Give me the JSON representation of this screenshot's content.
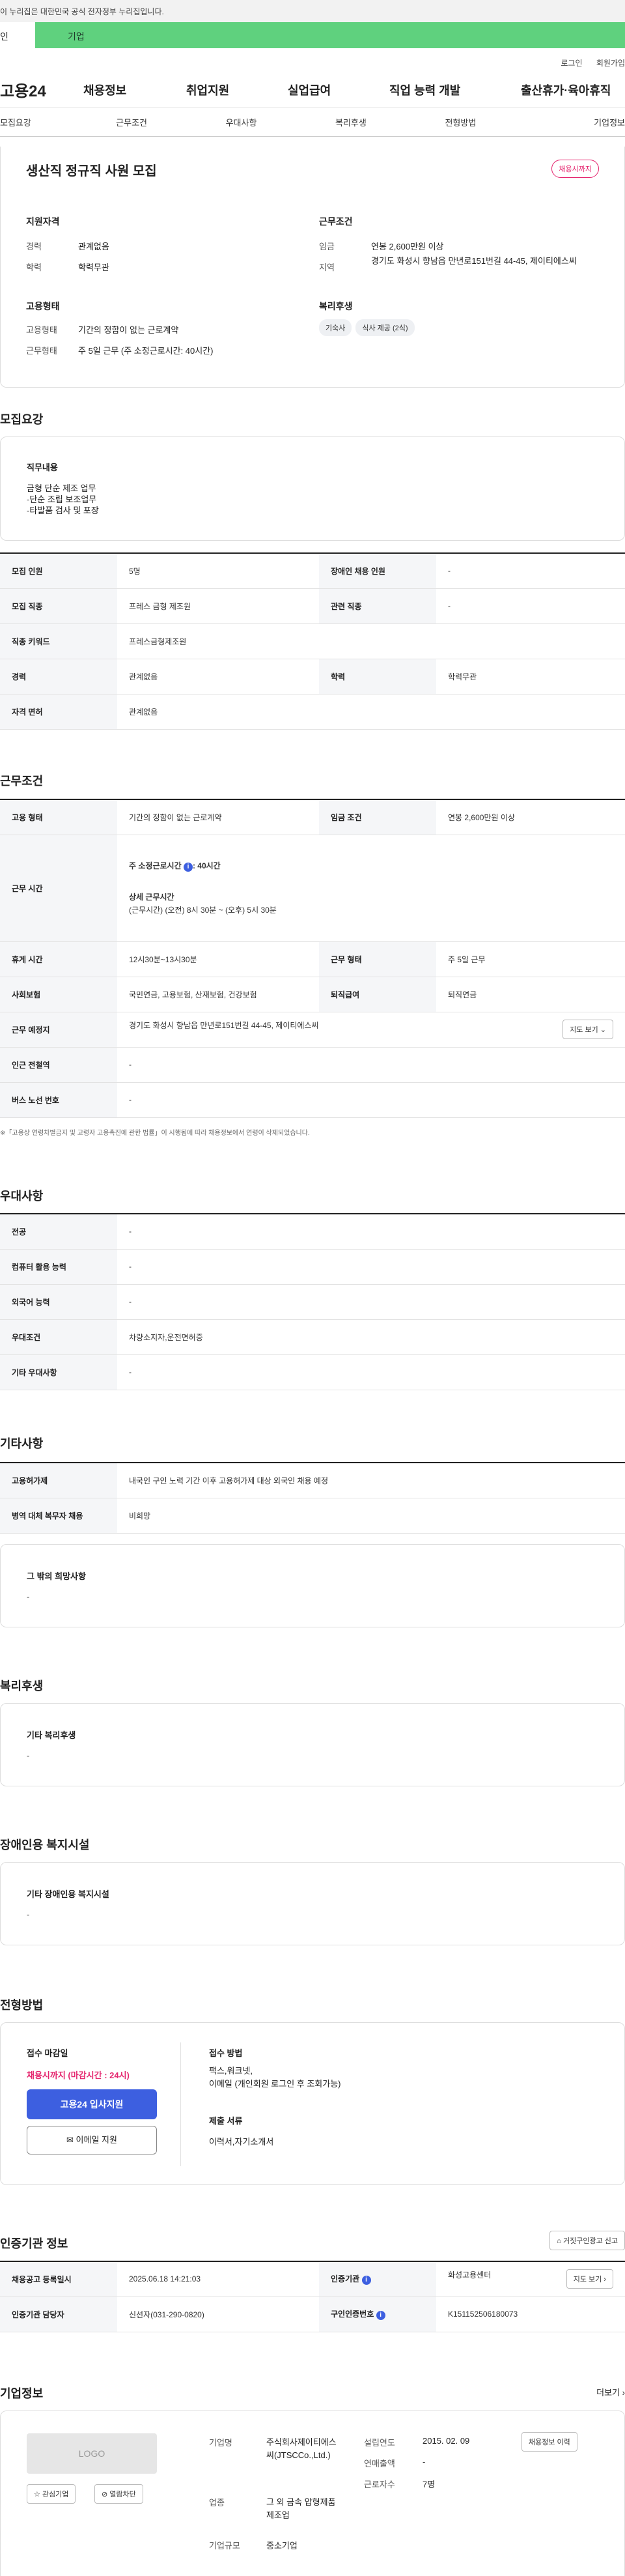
{
  "gov_banner": "이 누리집은 대한민국 공식 전자정부 누리집입니다.",
  "tabs": {
    "person": "인",
    "company": "기업"
  },
  "util": {
    "login": "로그인",
    "join": "회원가입"
  },
  "brand": {
    "logo": "고용24"
  },
  "gnb": [
    "채용정보",
    "취업지원",
    "실업급여",
    "직업 능력 개발",
    "출산휴가·육아휴직"
  ],
  "subnav": [
    "모집요강",
    "근무조건",
    "우대사항",
    "복리후생",
    "전형방법",
    "기업정보"
  ],
  "job": {
    "title": "생산직 정규직 사원 모집",
    "badge": "채용시까지",
    "qual_label": "지원자격",
    "career_k": "경력",
    "career_v": "관계없음",
    "edu_k": "학력",
    "edu_v": "학력무관",
    "emp_label": "고용형태",
    "emp_k": "고용형태",
    "emp_v": "기간의 정함이 없는 근로계약",
    "work_k": "근무형태",
    "work_v": "주 5일 근무 (주 소정근로시간: 40시간)",
    "cond_label": "근무조건",
    "wage_k": "임금",
    "wage_v": "연봉 2,600만원 이상",
    "loc_k": "지역",
    "loc_v": "경기도 화성시 향남읍 만년로151번길 44-45, 제이티에스씨",
    "welfare_label": "복리후생",
    "chips": [
      "기숙사",
      "식사 제공 (2식)"
    ]
  },
  "recruit": {
    "title": "모집요강",
    "duty_label": "직무내용",
    "duty_lines": [
      "금형 단순 제조 업무",
      "-단순 조립 보조업무",
      "-타발품 검사 및 포장"
    ],
    "rows": [
      {
        "k1": "모집 인원",
        "v1": "5명",
        "k2": "장애인 채용 인원",
        "v2": "-"
      },
      {
        "k1": "모집 직종",
        "v1": "프레스 금형 제조원",
        "k2": "관련 직종",
        "v2": "-"
      },
      {
        "k1": "직종 키워드",
        "v1": "프레스금형제조원"
      },
      {
        "k1": "경력",
        "v1": "관계없음",
        "k2": "학력",
        "v2": "학력무관"
      },
      {
        "k1": "자격 면허",
        "v1": "관계없음"
      }
    ]
  },
  "conditions": {
    "title": "근무조건",
    "emp_k": "고용 형태",
    "emp_v": "기간의 정함이 없는 근로계약",
    "wage_k": "임금 조건",
    "wage_v": "연봉 2,600만원 이상",
    "hours_k": "근무 시간",
    "hours_weekly": "주 소정근로시간",
    "hours_weekly_v": ": 40시간",
    "hours_detail_label": "상세 근무시간",
    "hours_detail_v": "(근무시간) (오전) 8시 30분 ~ (오후) 5시 30분",
    "break_k": "휴게 시간",
    "break_v": "12시30분~13시30분",
    "worktype_k": "근무 형태",
    "worktype_v": "주 5일 근무",
    "ins_k": "사회보험",
    "ins_v": "국민연금, 고용보험, 산재보험, 건강보험",
    "ret_k": "퇴직급여",
    "ret_v": "퇴직연금",
    "place_k": "근무 예정지",
    "place_v": "경기도 화성시 향남읍 만년로151번길 44-45, 제이티에스씨",
    "map_btn": "지도 보기",
    "subway_k": "인근 전철역",
    "subway_v": "-",
    "bus_k": "버스 노선 번호",
    "bus_v": "-",
    "note": "※「고용상 연령차별금지 및 고령자 고용촉진에 관한 법률」이 시행됨에 따라 채용정보에서 연령이 삭제되었습니다."
  },
  "preference": {
    "title": "우대사항",
    "rows": [
      {
        "k": "전공",
        "v": "-"
      },
      {
        "k": "컴퓨터 활용 능력",
        "v": "-"
      },
      {
        "k": "외국어 능력",
        "v": "-"
      },
      {
        "k": "우대조건",
        "v": "차량소지자,운전면허증"
      },
      {
        "k": "기타 우대사항",
        "v": "-"
      }
    ]
  },
  "etc": {
    "title": "기타사항",
    "foreign_k": "고용허가제",
    "foreign_v": "내국인 구인 노력 기간 이후 고용허가제 대상 외국인 채용 예정",
    "military_k": "병역 대체 복무자 채용",
    "military_v": "비희망",
    "other_label": "그 밖의 희망사항",
    "other_v": "-"
  },
  "welfare": {
    "title": "복리후생",
    "label": "기타 복리후생",
    "value": "-"
  },
  "disability": {
    "title": "장애인용 복지시설",
    "label": "기타 장애인용 복지시설",
    "value": "-"
  },
  "selection": {
    "title": "전형방법",
    "deadline_label": "접수 마감일",
    "deadline_v": "채용시까지 (마감시간 : 24시)",
    "apply_btn": "고용24 입사지원",
    "email_btn": "이메일 지원",
    "method_label": "접수 방법",
    "method_v1": "팩스,워크넷,",
    "method_v2": "이메일 (개인회원 로그인 후 조회가능)",
    "docs_label": "제출 서류",
    "docs_v": "이력서,자기소개서"
  },
  "cert": {
    "title": "인증기관 정보",
    "report_btn": "거짓구인광고 신고",
    "reg_k": "채용공고 등록일시",
    "reg_v": "2025.06.18 14:21:03",
    "org_k": "인증기관",
    "org_v": "화성고용센터",
    "map_btn": "지도 보기",
    "mgr_k": "인증기관 담당자",
    "mgr_v": "신선자(031-290-0820)",
    "no_k": "구인인증번호",
    "no_v": "K151152506180073"
  },
  "company": {
    "title": "기업정보",
    "more": "더보기",
    "logo": "LOGO",
    "fav_btn": "관심기업",
    "block_btn": "열람차단",
    "name_k": "기업명",
    "name_v": "주식회사제이티에스씨(JTSCCo.,Ltd.)",
    "ind_k": "업종",
    "ind_v": "그 외 금속 압형제품 제조업",
    "size_k": "기업규모",
    "size_v": "중소기업",
    "est_k": "설립연도",
    "est_v": "2015. 02. 09",
    "sales_k": "연매출액",
    "sales_v": "-",
    "emp_k": "근로자수",
    "emp_v": "7명",
    "history_btn": "채용정보 이력"
  }
}
